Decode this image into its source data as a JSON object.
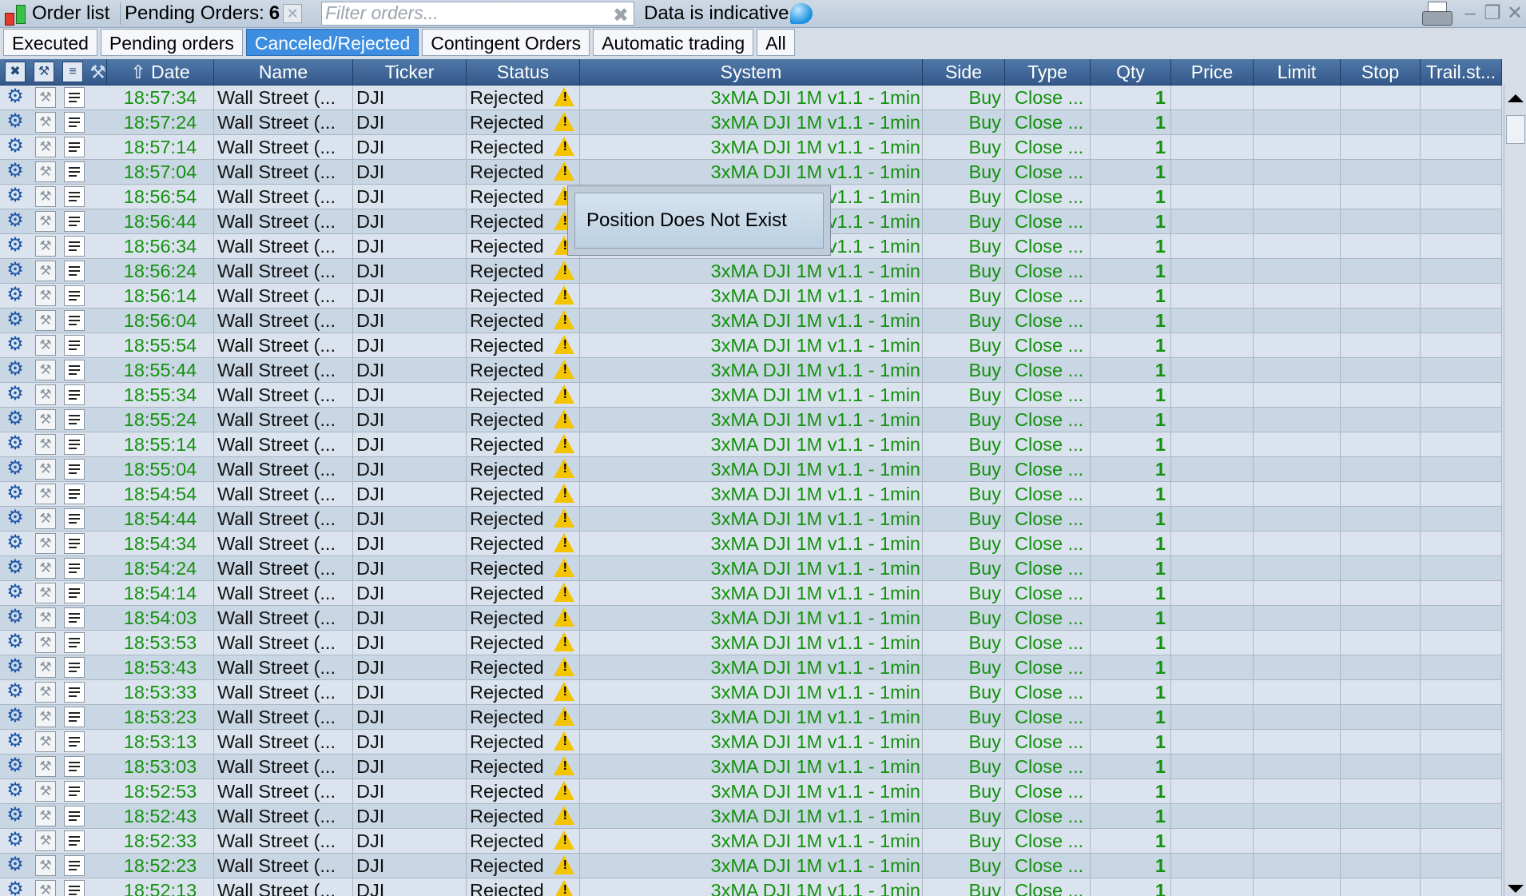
{
  "topbar": {
    "title": "Order list",
    "pending_label": "Pending Orders:",
    "pending_count": "6",
    "filter_placeholder": "Filter orders...",
    "data_notice": "Data is indicative"
  },
  "tabs": [
    {
      "label": "Executed",
      "active": false
    },
    {
      "label": "Pending orders",
      "active": false
    },
    {
      "label": "Canceled/Rejected",
      "active": true
    },
    {
      "label": "Contingent Orders",
      "active": false
    },
    {
      "label": "Automatic trading",
      "active": false
    },
    {
      "label": "All",
      "active": false
    }
  ],
  "columns": {
    "date": "Date",
    "name": "Name",
    "ticker": "Ticker",
    "status": "Status",
    "system": "System",
    "side": "Side",
    "type": "Type",
    "qty": "Qty",
    "price": "Price",
    "limit": "Limit",
    "stop": "Stop",
    "trail": "Trail.st..."
  },
  "row_defaults": {
    "name": "Wall Street (...",
    "ticker": "DJI",
    "status": "Rejected",
    "system": "3xMA DJI 1M v1.1 - 1min",
    "side": "Buy",
    "type": "Close ...",
    "qty": "1"
  },
  "rows": [
    {
      "date": "18:57:34"
    },
    {
      "date": "18:57:24"
    },
    {
      "date": "18:57:14"
    },
    {
      "date": "18:57:04"
    },
    {
      "date": "18:56:54"
    },
    {
      "date": "18:56:44"
    },
    {
      "date": "18:56:34"
    },
    {
      "date": "18:56:24"
    },
    {
      "date": "18:56:14"
    },
    {
      "date": "18:56:04"
    },
    {
      "date": "18:55:54"
    },
    {
      "date": "18:55:44"
    },
    {
      "date": "18:55:34"
    },
    {
      "date": "18:55:24"
    },
    {
      "date": "18:55:14"
    },
    {
      "date": "18:55:04"
    },
    {
      "date": "18:54:54"
    },
    {
      "date": "18:54:44"
    },
    {
      "date": "18:54:34"
    },
    {
      "date": "18:54:24"
    },
    {
      "date": "18:54:14"
    },
    {
      "date": "18:54:03"
    },
    {
      "date": "18:53:53"
    },
    {
      "date": "18:53:43"
    },
    {
      "date": "18:53:33"
    },
    {
      "date": "18:53:23"
    },
    {
      "date": "18:53:13"
    },
    {
      "date": "18:53:03"
    },
    {
      "date": "18:52:53"
    },
    {
      "date": "18:52:43"
    },
    {
      "date": "18:52:33"
    },
    {
      "date": "18:52:23"
    },
    {
      "date": "18:52:13"
    }
  ],
  "tooltip": {
    "text": "Position Does Not Exist"
  },
  "colors": {
    "accent_tab": "#3d8ee0",
    "header_bg": "#34598a",
    "value_green": "#14910f",
    "warning_yellow": "#f5c400"
  }
}
